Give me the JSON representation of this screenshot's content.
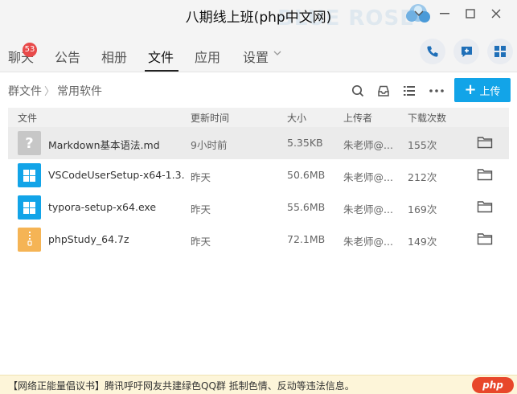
{
  "window": {
    "title": "八期线上班(php中文网)",
    "deco_text": "BLUE ROSE"
  },
  "tabs": [
    {
      "label": "聊天",
      "badge": "53"
    },
    {
      "label": "公告"
    },
    {
      "label": "相册"
    },
    {
      "label": "文件",
      "active": true
    },
    {
      "label": "应用"
    },
    {
      "label": "设置"
    }
  ],
  "breadcrumb": {
    "root": "群文件",
    "separator": "〉",
    "current": "常用软件"
  },
  "toolbar": {
    "upload_label": "上传",
    "icons": [
      "search-icon",
      "inbox-icon",
      "list-view-icon",
      "more-icon"
    ]
  },
  "table": {
    "columns": [
      "文件",
      "更新时间",
      "大小",
      "上传者",
      "下载次数"
    ],
    "rows": [
      {
        "name": "Markdown基本语法.md",
        "time": "9小时前",
        "size": "5.35KB",
        "uploader": "朱老师@...",
        "downloads": "155次",
        "icon": "unknown-file-icon",
        "icon_color": "#c7c7c7"
      },
      {
        "name": "VSCodeUserSetup-x64-1.3...",
        "time": "昨天",
        "size": "50.6MB",
        "uploader": "朱老师@...",
        "downloads": "212次",
        "icon": "windows-exe-icon",
        "icon_color": "#12a4e8"
      },
      {
        "name": "typora-setup-x64.exe",
        "time": "昨天",
        "size": "55.6MB",
        "uploader": "朱老师@...",
        "downloads": "169次",
        "icon": "windows-exe-icon",
        "icon_color": "#12a4e8"
      },
      {
        "name": "phpStudy_64.7z",
        "time": "昨天",
        "size": "72.1MB",
        "uploader": "朱老师@...",
        "downloads": "149次",
        "icon": "archive-file-icon",
        "icon_color": "#f5b455"
      }
    ]
  },
  "footer": {
    "notice": "【网络正能量倡议书】腾讯呼吁网友共建绿色QQ群 抵制色情、反动等违法信息。",
    "watermark": "php"
  },
  "colors": {
    "accent": "#12a4e8",
    "badge": "#e84a4a",
    "footer_bg": "#fdf5d9"
  }
}
